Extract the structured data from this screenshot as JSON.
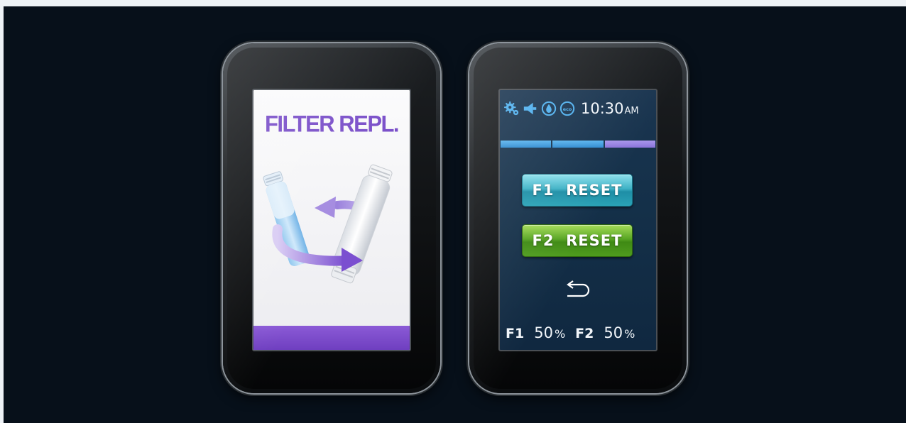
{
  "left_screen": {
    "title": "FILTER REPL.",
    "title_color": "#7a4fc9",
    "illustration": "filter-replacement-icon",
    "footer_bar_color": "#7a4fc9"
  },
  "right_screen": {
    "status_icons": [
      "gear-icon",
      "speaker-icon",
      "water-drop-icon",
      "eco-icon"
    ],
    "clock": {
      "time": "10:30",
      "period": "AM"
    },
    "progress_segments": [
      {
        "color": "#3a9be0",
        "state": "filled"
      },
      {
        "color": "#3a9be0",
        "state": "filled"
      },
      {
        "color": "#9a86e4",
        "state": "partial"
      }
    ],
    "buttons": {
      "f1_reset": "F1  RESET",
      "f2_reset": "F2  RESET",
      "back": "back-arrow-icon"
    },
    "filters": [
      {
        "name": "F1",
        "value": "50",
        "unit": "%"
      },
      {
        "name": "F2",
        "value": "50",
        "unit": "%"
      }
    ]
  }
}
